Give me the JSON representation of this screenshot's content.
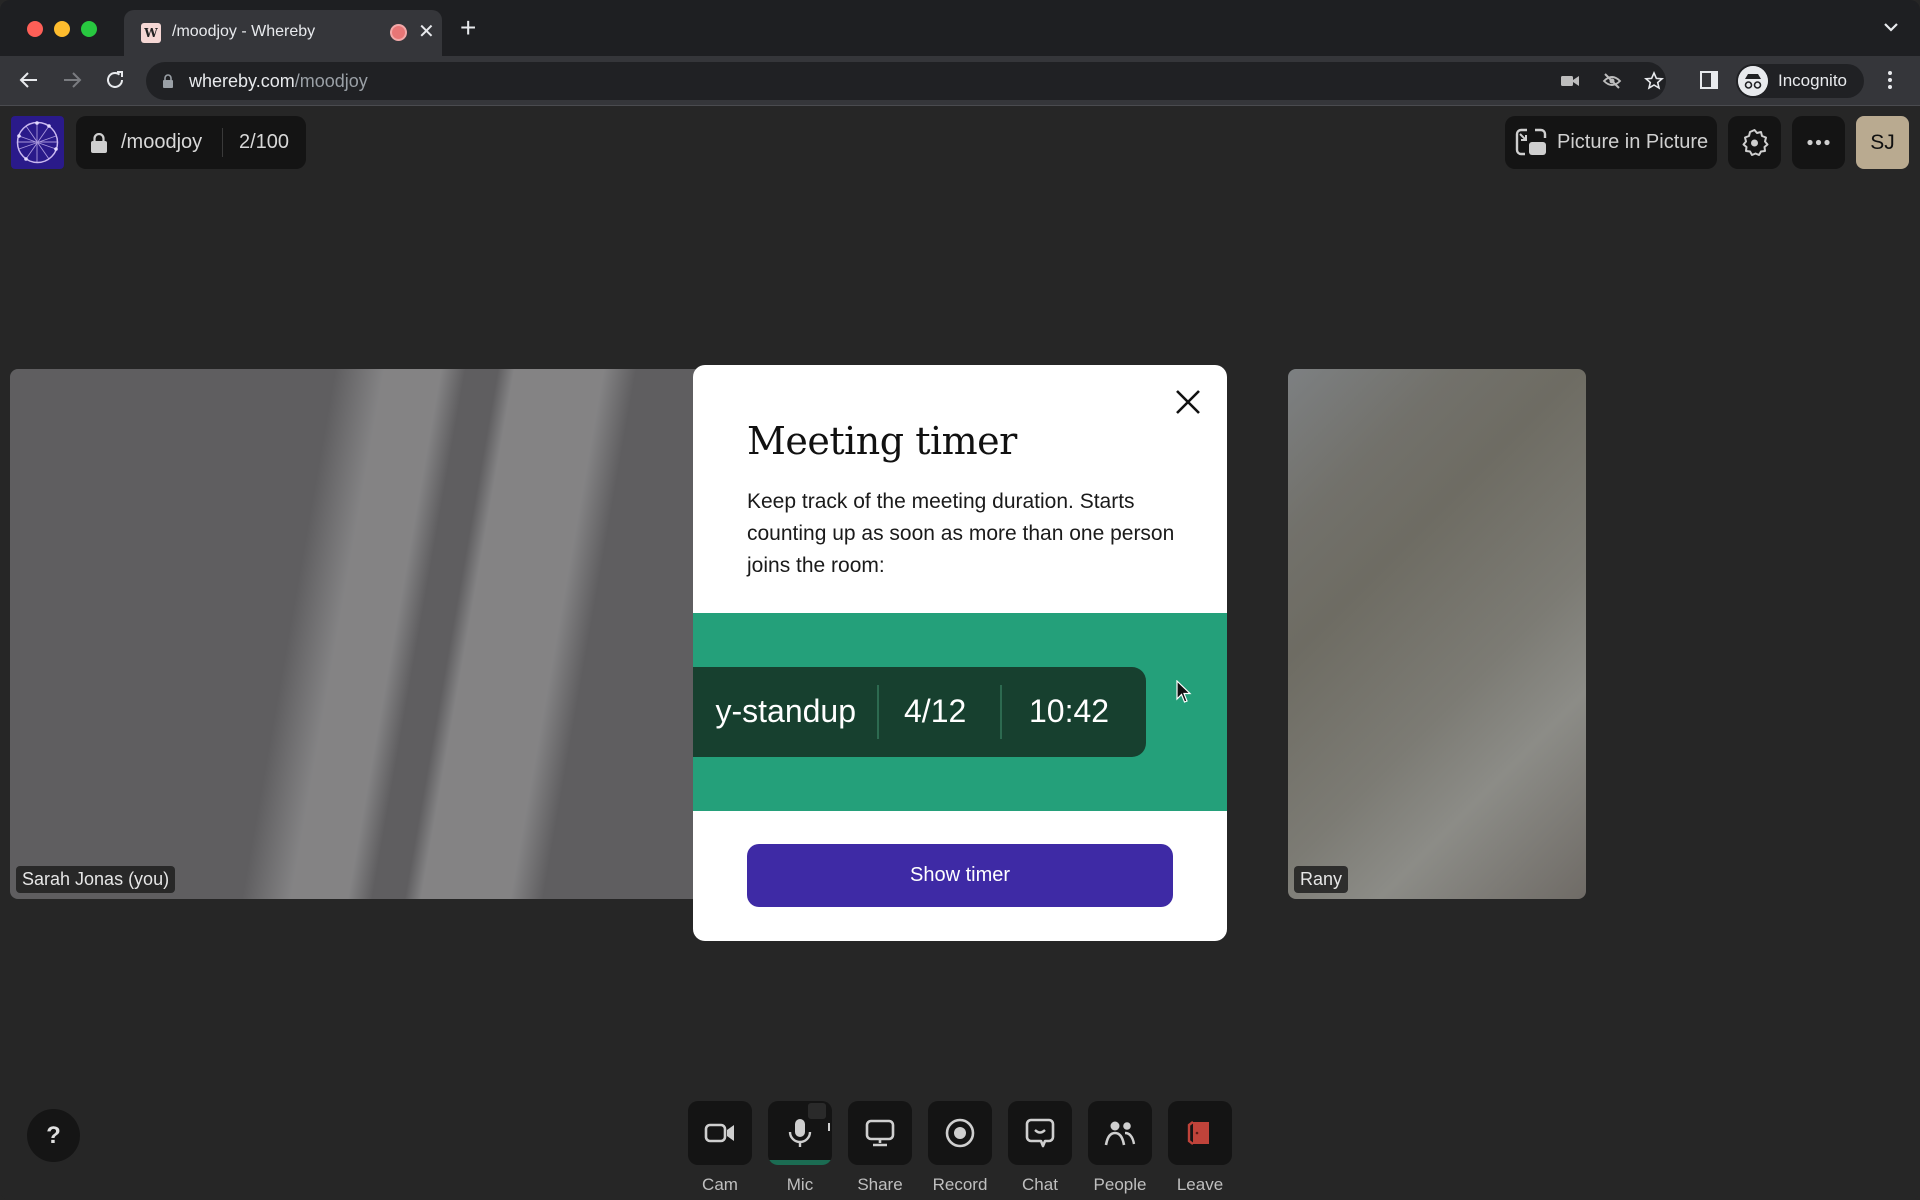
{
  "browser": {
    "tab_title": "/moodjoy - Whereby",
    "tab_favicon": "W",
    "url_host": "whereby.com",
    "url_path": "/moodjoy",
    "profile_label": "Incognito"
  },
  "room": {
    "name": "/moodjoy",
    "participant_count": "2/100",
    "pip_label": "Picture in Picture",
    "avatar_initials": "SJ"
  },
  "participants": [
    {
      "name": "Sarah Jonas (you)"
    },
    {
      "name": "Rany"
    }
  ],
  "modal": {
    "title": "Meeting timer",
    "description": "Keep track of the meeting duration. Starts counting up as soon as more than one person joins the room:",
    "preview_room": "daily-standup",
    "preview_room_visible": "y-standup",
    "preview_count": "4/12",
    "preview_time": "10:42",
    "button_label": "Show timer"
  },
  "controls": [
    {
      "label": "Cam",
      "icon": "camera-icon"
    },
    {
      "label": "Mic",
      "icon": "microphone-icon"
    },
    {
      "label": "Share",
      "icon": "screen-share-icon"
    },
    {
      "label": "Record",
      "icon": "record-icon"
    },
    {
      "label": "Chat",
      "icon": "chat-icon"
    },
    {
      "label": "People",
      "icon": "people-icon"
    },
    {
      "label": "Leave",
      "icon": "door-icon"
    }
  ],
  "help_label": "?",
  "colors": {
    "brand_purple": "#3e2aa5",
    "timer_green": "#24a07a",
    "timer_dark": "#17402f",
    "leave_red": "#c0433a"
  }
}
